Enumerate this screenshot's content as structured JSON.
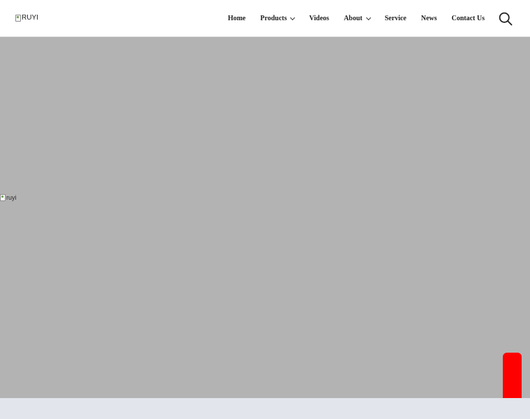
{
  "header": {
    "logo_alt": "RUYI",
    "nav": {
      "home": "Home",
      "products": "Products",
      "videos": "Videos",
      "about": "About",
      "service": "Service",
      "news": "News",
      "contact": "Contact Us"
    },
    "search_icon": "search-icon"
  },
  "hero": {
    "image_alt": "ruyi"
  },
  "colors": {
    "hero_bg": "#b3b3b3",
    "widget": "#ff0000",
    "footer_band": "#e2e5ec"
  }
}
